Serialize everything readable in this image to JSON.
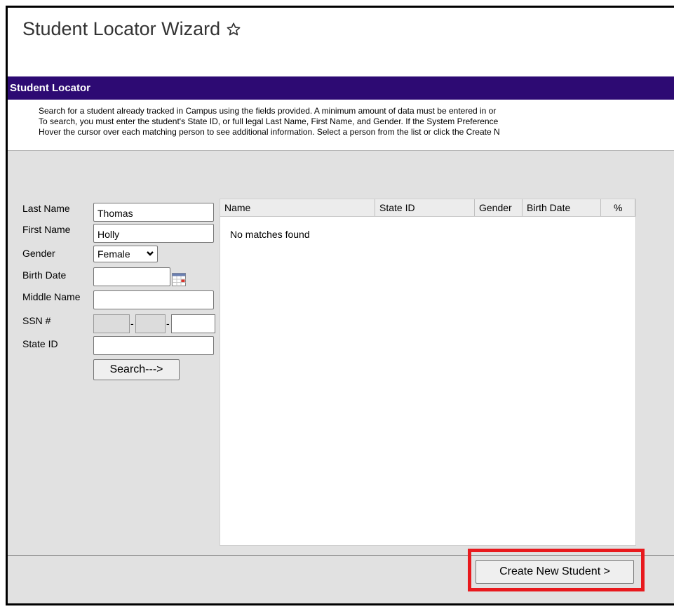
{
  "header": {
    "title": "Student Locator Wizard",
    "favorite_icon": "star-outline-icon"
  },
  "section": {
    "title": "Student Locator"
  },
  "instructions": {
    "lines": [
      "Search for a student already tracked in Campus using the fields provided. A minimum amount of data must be entered in or",
      "To search, you must enter the student's State ID, or full legal Last Name, First Name, and Gender. If the System Preference",
      "Hover the cursor over each matching person to see additional information. Select a person from the list or click the Create N"
    ]
  },
  "form": {
    "last_name": {
      "label": "Last Name",
      "value": "Thomas"
    },
    "first_name": {
      "label": "First Name",
      "value": "Holly"
    },
    "gender": {
      "label": "Gender",
      "value": "Female"
    },
    "birth_date": {
      "label": "Birth Date",
      "value": "",
      "icon": "calendar-icon"
    },
    "middle_name": {
      "label": "Middle Name",
      "value": ""
    },
    "ssn": {
      "label": "SSN #",
      "dash": "-"
    },
    "state_id": {
      "label": "State ID",
      "value": ""
    },
    "search_button": "Search--->"
  },
  "results": {
    "columns": [
      "Name",
      "State ID",
      "Gender",
      "Birth Date",
      "%"
    ],
    "empty_message": "No matches found"
  },
  "footer": {
    "create_button": "Create New Student >"
  },
  "colors": {
    "section_bar": "#2d0a73",
    "highlight": "#e8191d",
    "workarea": "#e1e1e1"
  }
}
